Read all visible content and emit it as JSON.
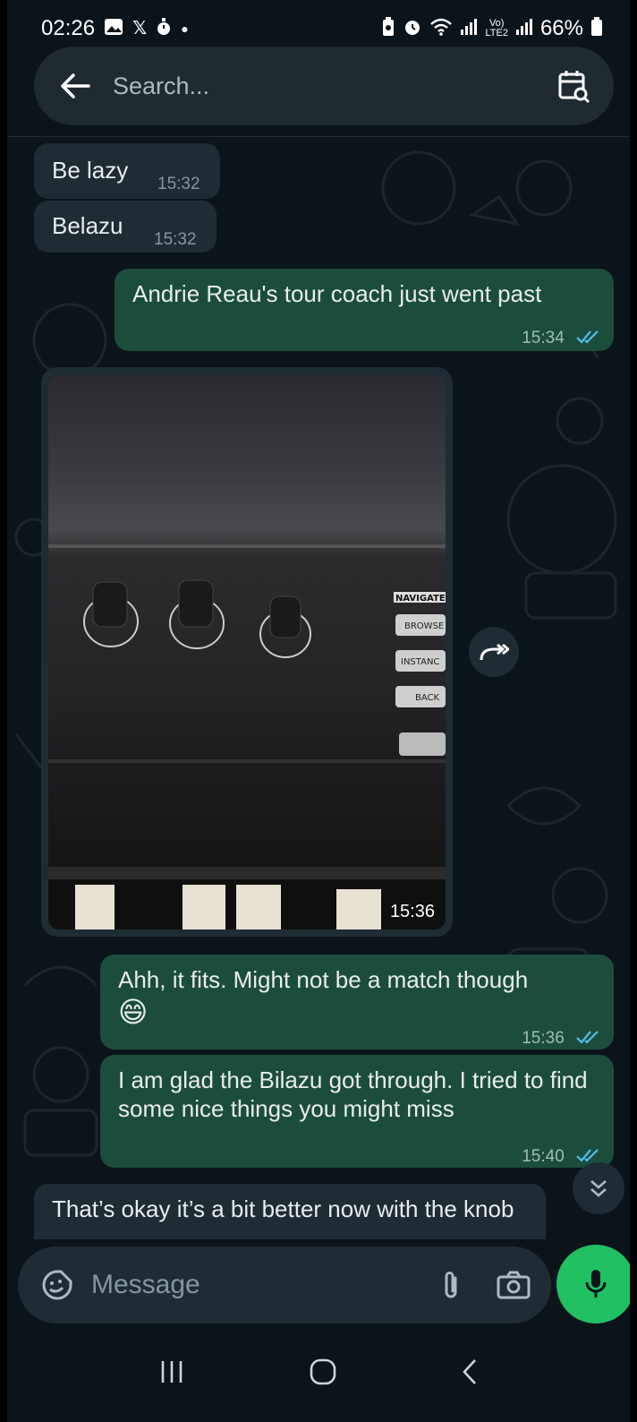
{
  "status_bar": {
    "time": "02:26",
    "battery": "66%",
    "left_icons": [
      "gallery-icon",
      "x-icon",
      "stopwatch-icon",
      "dot-icon"
    ],
    "right_icons": [
      "battery-saver-icon",
      "alarm-icon",
      "wifi-icon",
      "signal-icon",
      "volte-icon",
      "signal-icon"
    ]
  },
  "search": {
    "placeholder": "Search..."
  },
  "messages": [
    {
      "direction": "in",
      "text": "Be lazy",
      "time": "15:32"
    },
    {
      "direction": "in",
      "text": "Belazu",
      "time": "15:32"
    },
    {
      "direction": "out",
      "text": "Andrie Reau's tour coach just went past",
      "time": "15:34",
      "read": true
    },
    {
      "direction": "in",
      "type": "image",
      "time": "15:36",
      "image_labels": [
        "NAVIGATE",
        "BROWSE",
        "INSTANC",
        "BACK"
      ]
    },
    {
      "direction": "out",
      "text": "Ahh, it fits. Might not be a match though",
      "emoji": "😄",
      "time": "15:36",
      "read": true
    },
    {
      "direction": "out",
      "text": "I am glad the Bilazu got through. I tried to find some nice things you might miss",
      "time": "15:40",
      "read": true
    },
    {
      "direction": "in",
      "text": "That’s okay it’s a bit better now with the knob"
    }
  ],
  "composer": {
    "placeholder": "Message"
  },
  "colors": {
    "background": "#0b141a",
    "incoming": "#1f2c34",
    "outgoing": "#1c4d3c",
    "accent": "#21c063",
    "read_ticks": "#53bdeb"
  }
}
